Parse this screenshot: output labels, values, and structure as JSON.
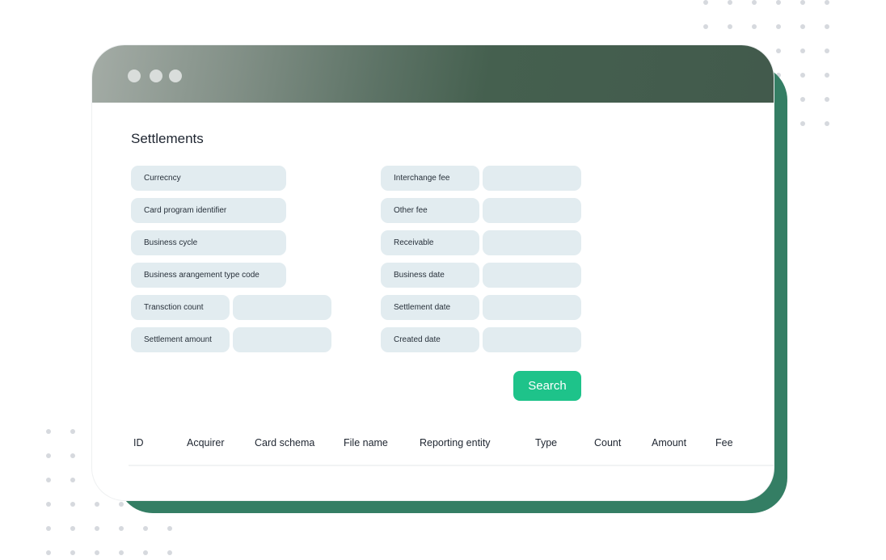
{
  "window": {
    "controls": [
      "window-dot",
      "window-dot",
      "window-dot"
    ]
  },
  "page": {
    "title": "Settlements"
  },
  "filters": {
    "left": [
      {
        "label": "Currecncy",
        "value": ""
      },
      {
        "label": "Card program identifier",
        "value": ""
      },
      {
        "label": "Business cycle",
        "value": ""
      },
      {
        "label": "Business arangement type code",
        "value": ""
      },
      {
        "label": "Transction count",
        "value": ""
      },
      {
        "label": "Settlement amount",
        "value": ""
      }
    ],
    "right": [
      {
        "label": "Interchange fee",
        "value": ""
      },
      {
        "label": "Other fee",
        "value": ""
      },
      {
        "label": "Receivable",
        "value": ""
      },
      {
        "label": "Business date",
        "value": ""
      },
      {
        "label": "Settlement date",
        "value": ""
      },
      {
        "label": "Created date",
        "value": ""
      }
    ]
  },
  "actions": {
    "search_label": "Search"
  },
  "table": {
    "columns": [
      "ID",
      "Acquirer",
      "Card schema",
      "File name",
      "Reporting entity",
      "Type",
      "Count",
      "Amount",
      "Fee"
    ],
    "rows": []
  },
  "colors": {
    "accent": "#1ec38a",
    "frame_green": "#347e64",
    "titlebar_dark": "#425a4c",
    "field_bg": "#e2ecf0"
  }
}
